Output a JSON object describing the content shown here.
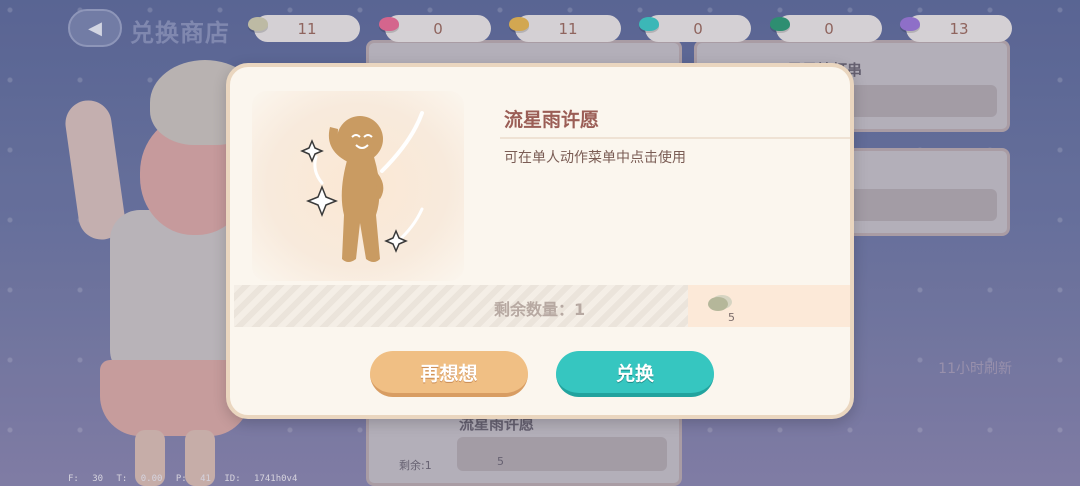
{
  "header": {
    "back_glyph": "◀",
    "title": "兑换商店"
  },
  "currencies": [
    {
      "icon": "beige-gem-icon",
      "color": "#cfcbb0",
      "value": "11"
    },
    {
      "icon": "pink-gem-icon",
      "color": "#e86c97",
      "value": "0"
    },
    {
      "icon": "gold-gem-icon",
      "color": "#e6b654",
      "value": "11"
    },
    {
      "icon": "cyan-gem-icon",
      "color": "#3fc8c6",
      "value": "0"
    },
    {
      "icon": "green-gem-icon",
      "color": "#2f9a78",
      "value": "0"
    },
    {
      "icon": "purple-gem-icon",
      "color": "#9a78d8",
      "value": "13"
    }
  ],
  "background_shop": {
    "card_title_right": "星星挂灯串",
    "refresh_text": "11小时刷新",
    "bottom_card_title": "流星雨许愿",
    "bottom_card_remaining": "剩余:1",
    "bottom_card_price": "5"
  },
  "debug": "F: 30  T: 0.00  P: 41  ID: 1741h0v4",
  "modal": {
    "item_name": "流星雨许愿",
    "item_desc": "可在单人动作菜单中点击使用",
    "remaining_label": "剩余数量：1",
    "price": "5",
    "cancel_label": "再想想",
    "confirm_label": "兑换",
    "colors": {
      "accent_confirm": "#36c6c0",
      "accent_cancel": "#f0bf84",
      "figure": "#c99b62"
    }
  }
}
